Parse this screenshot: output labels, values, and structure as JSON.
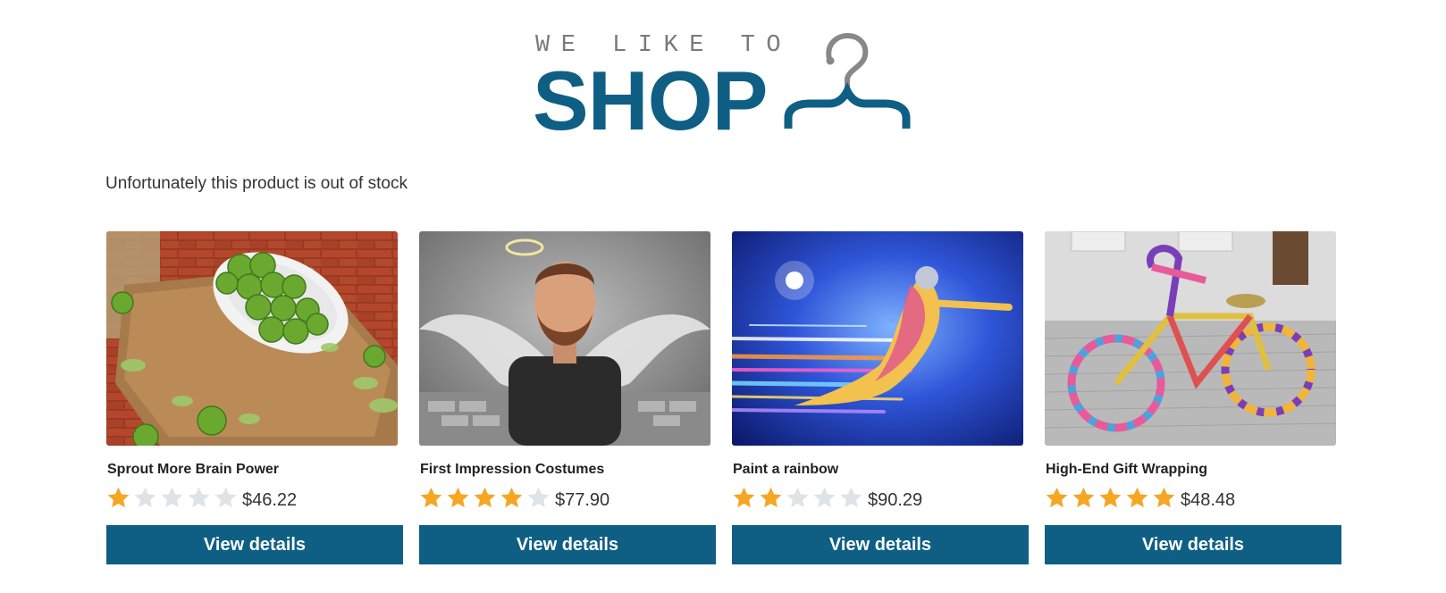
{
  "header": {
    "logo_tagline": "WE LIKE TO",
    "logo_word": "SHOP"
  },
  "message": "Unfortunately this product is out of stock",
  "colors": {
    "brand": "#0f5f85",
    "star_filled": "#f5a623",
    "star_empty": "#dde3e6"
  },
  "products": [
    {
      "title": "Sprout More Brain Power",
      "rating": 1,
      "price": "$46.22",
      "button": "View details"
    },
    {
      "title": "First Impression Costumes",
      "rating": 4,
      "price": "$77.90",
      "button": "View details"
    },
    {
      "title": "Paint a rainbow",
      "rating": 2,
      "price": "$90.29",
      "button": "View details"
    },
    {
      "title": "High-End Gift Wrapping",
      "rating": 5,
      "price": "$48.48",
      "button": "View details"
    }
  ]
}
